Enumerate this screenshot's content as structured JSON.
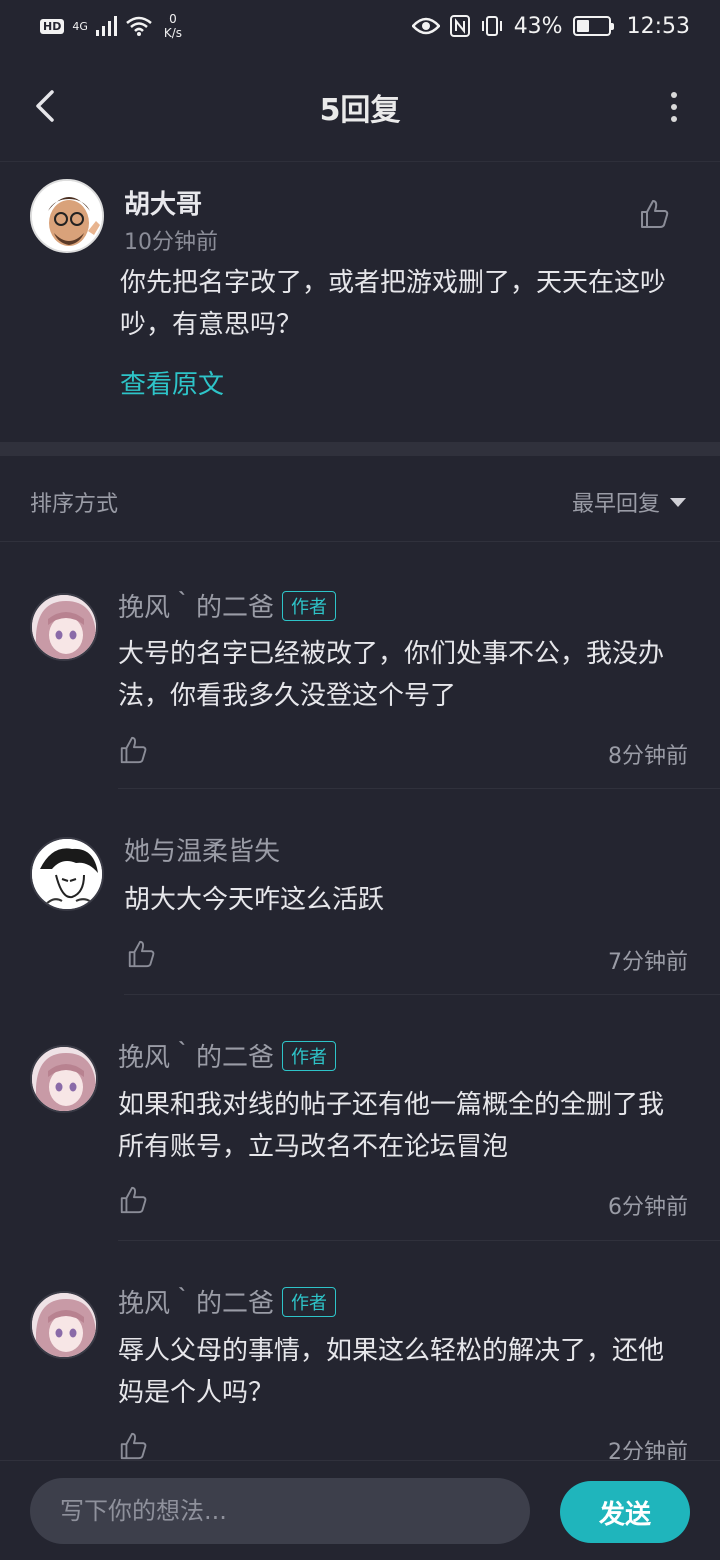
{
  "status_bar": {
    "hd": "HD",
    "network": "4G",
    "net_speed_value": "0",
    "net_speed_unit": "K/s",
    "battery_percent": "43%",
    "battery_level": 0.43,
    "time": "12:53",
    "icons": [
      "signal-icon",
      "wifi-icon",
      "eye-icon",
      "nfc-icon",
      "vibrate-icon",
      "battery-icon"
    ]
  },
  "header": {
    "title": "5回复"
  },
  "post": {
    "author": "胡大哥",
    "time": "10分钟前",
    "text": "你先把名字改了，或者把游戏删了，天天在这吵吵，有意思吗？",
    "view_original": "查看原文"
  },
  "sort": {
    "label": "排序方式",
    "selected": "最早回复"
  },
  "replies": [
    {
      "name": "挽风｀的二爸",
      "tag": "作者",
      "text": "大号的名字已经被改了，你们处事不公，我没办法，你看我多久没登这个号了",
      "time": "8分钟前"
    },
    {
      "name": "她与温柔皆失",
      "tag": "",
      "text": "胡大大今天咋这么活跃",
      "time": "7分钟前"
    },
    {
      "name": "挽风｀的二爸",
      "tag": "作者",
      "text": "如果和我对线的帖子还有他一篇概全的全删了我所有账号，立马改名不在论坛冒泡",
      "time": "6分钟前"
    },
    {
      "name": "挽风｀的二爸",
      "tag": "作者",
      "text": "辱人父母的事情，如果这么轻松的解决了，还他妈是个人吗？",
      "time": "2分钟前"
    }
  ],
  "bottom_bar": {
    "input_placeholder": "写下你的想法...",
    "send_label": "发送"
  },
  "colors": {
    "background": "#242530",
    "accent": "#2ec4c8",
    "send_button": "#1fb5bc"
  }
}
